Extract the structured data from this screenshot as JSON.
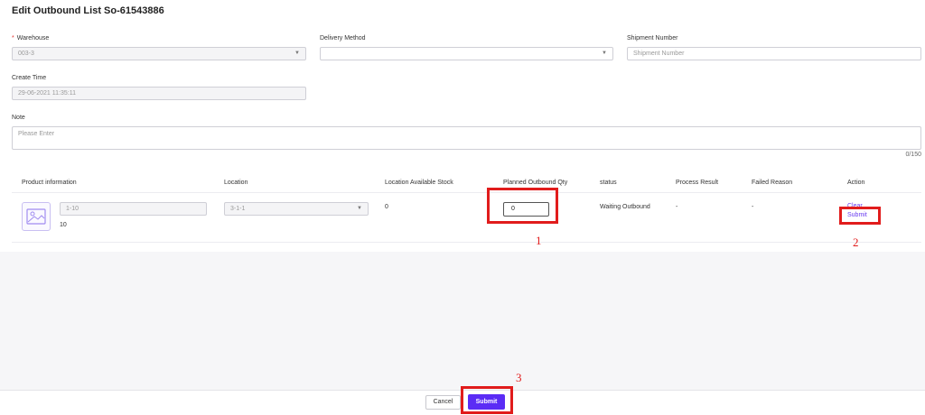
{
  "header": {
    "title": "Edit Outbound List So-61543886"
  },
  "form": {
    "warehouse": {
      "required_mark": "*",
      "label": "Warehouse",
      "value": "003-3"
    },
    "delivery": {
      "label": "Delivery Method",
      "value": ""
    },
    "shipment": {
      "label": "Shipment Number",
      "placeholder": "Shipment Number"
    },
    "create_time": {
      "label": "Create Time",
      "value": "29-06-2021 11:35:11"
    },
    "note": {
      "label": "Note",
      "placeholder": "Please Enter",
      "counter": "0/150"
    }
  },
  "table": {
    "headers": [
      "Product information",
      "Location",
      "Location Available Stock",
      "Planned Outbound Qty",
      "status",
      "Process Result",
      "Failed Reason",
      "Action"
    ],
    "row": {
      "sku": "1-10",
      "product_qty": "10",
      "location": "3-1-1",
      "available_stock": "0",
      "planned_qty": "0",
      "status": "Waiting Outbound",
      "process_result": "-",
      "failed_reason": "-",
      "action_clear": "Clear",
      "action_submit": "Submit"
    }
  },
  "annotations": {
    "a1": "1",
    "a2": "2",
    "a3": "3"
  },
  "footer": {
    "cancel": "Cancel",
    "submit": "Submit"
  },
  "icons": {
    "caret": "chevron-down-icon",
    "thumb": "image-placeholder-icon"
  },
  "colors": {
    "accent": "#5b2cf5",
    "link": "#6a3df0",
    "annotation": "#e11c1c",
    "required": "#e3342f"
  }
}
